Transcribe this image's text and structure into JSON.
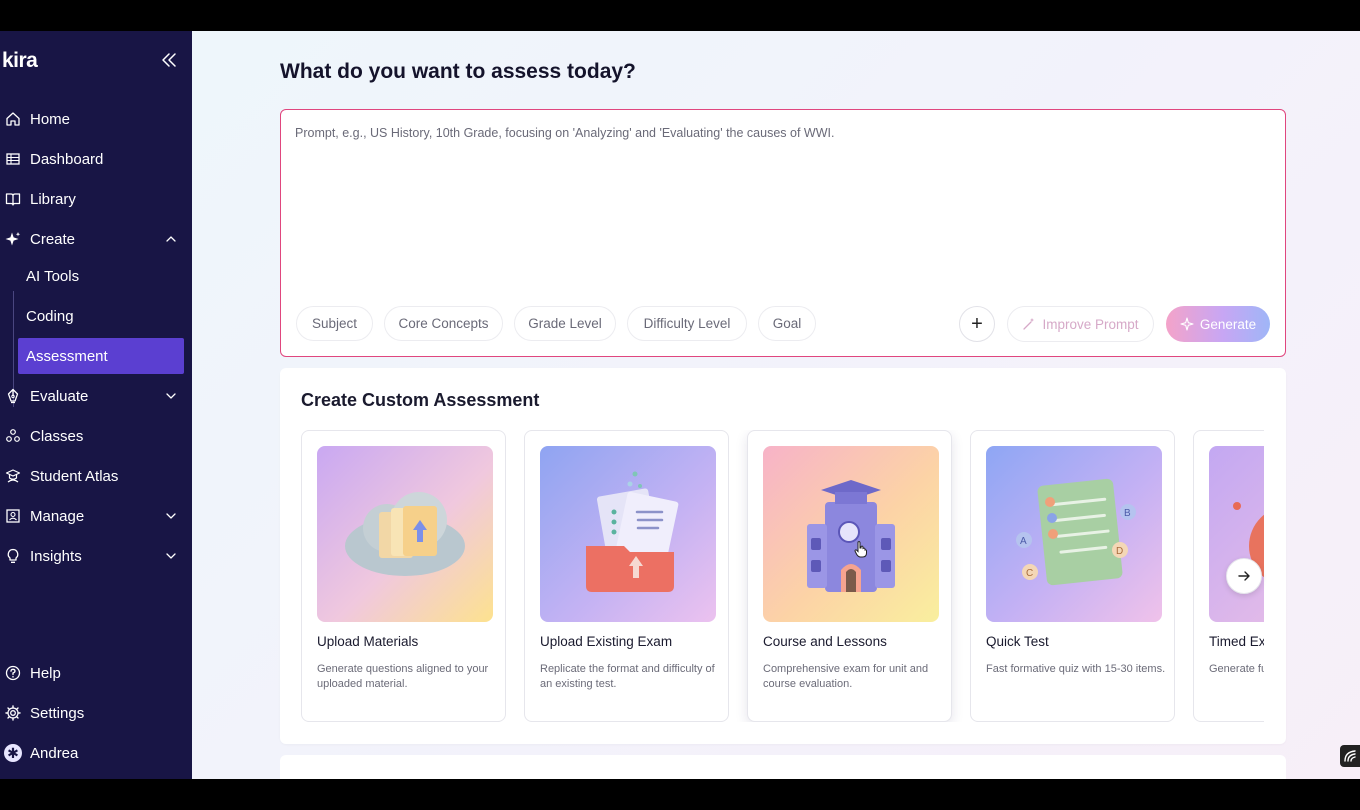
{
  "app": {
    "logo": "kira"
  },
  "sidebar": {
    "items": [
      {
        "label": "Home",
        "icon": "home-icon"
      },
      {
        "label": "Dashboard",
        "icon": "table-icon"
      },
      {
        "label": "Library",
        "icon": "book-icon"
      },
      {
        "label": "Create",
        "icon": "sparkle-icon",
        "expanded": true
      },
      {
        "label": "Evaluate",
        "icon": "pen-nib-icon",
        "expanded": false
      },
      {
        "label": "Classes",
        "icon": "classes-icon"
      },
      {
        "label": "Student Atlas",
        "icon": "student-icon"
      },
      {
        "label": "Manage",
        "icon": "manage-icon",
        "expanded": false
      },
      {
        "label": "Insights",
        "icon": "lightbulb-icon",
        "expanded": false
      }
    ],
    "create_sub": [
      {
        "label": "AI Tools"
      },
      {
        "label": "Coding"
      },
      {
        "label": "Assessment",
        "active": true
      }
    ],
    "bottom": [
      {
        "label": "Help",
        "icon": "help-icon"
      },
      {
        "label": "Settings",
        "icon": "settings-icon"
      },
      {
        "label": "Andrea",
        "icon": "avatar"
      }
    ]
  },
  "main": {
    "title": "What do you want to assess today?",
    "prompt": {
      "placeholder": "Prompt, e.g., US History, 10th Grade, focusing on 'Analyzing' and 'Evaluating' the causes of WWI.",
      "value": "",
      "chips": [
        "Subject",
        "Core Concepts",
        "Grade Level",
        "Difficulty Level",
        "Goal"
      ],
      "add_label": "+",
      "improve_label": "Improve Prompt",
      "generate_label": "Generate"
    },
    "custom": {
      "title": "Create Custom Assessment",
      "cards": [
        {
          "title": "Upload Materials",
          "desc": "Generate questions aligned to your uploaded material."
        },
        {
          "title": "Upload Existing Exam",
          "desc": "Replicate the format and difficulty of an existing test."
        },
        {
          "title": "Course and Lessons",
          "desc": "Comprehensive exam for unit and course evaluation."
        },
        {
          "title": "Quick Test",
          "desc": "Fast formative quiz with 15-30 items."
        },
        {
          "title": "Timed Exam",
          "desc": "Generate fully timed assessments."
        }
      ]
    }
  },
  "colors": {
    "sidebar_bg": "#181545",
    "active_item": "#5b3fd1",
    "prompt_border": "#e0467e"
  }
}
